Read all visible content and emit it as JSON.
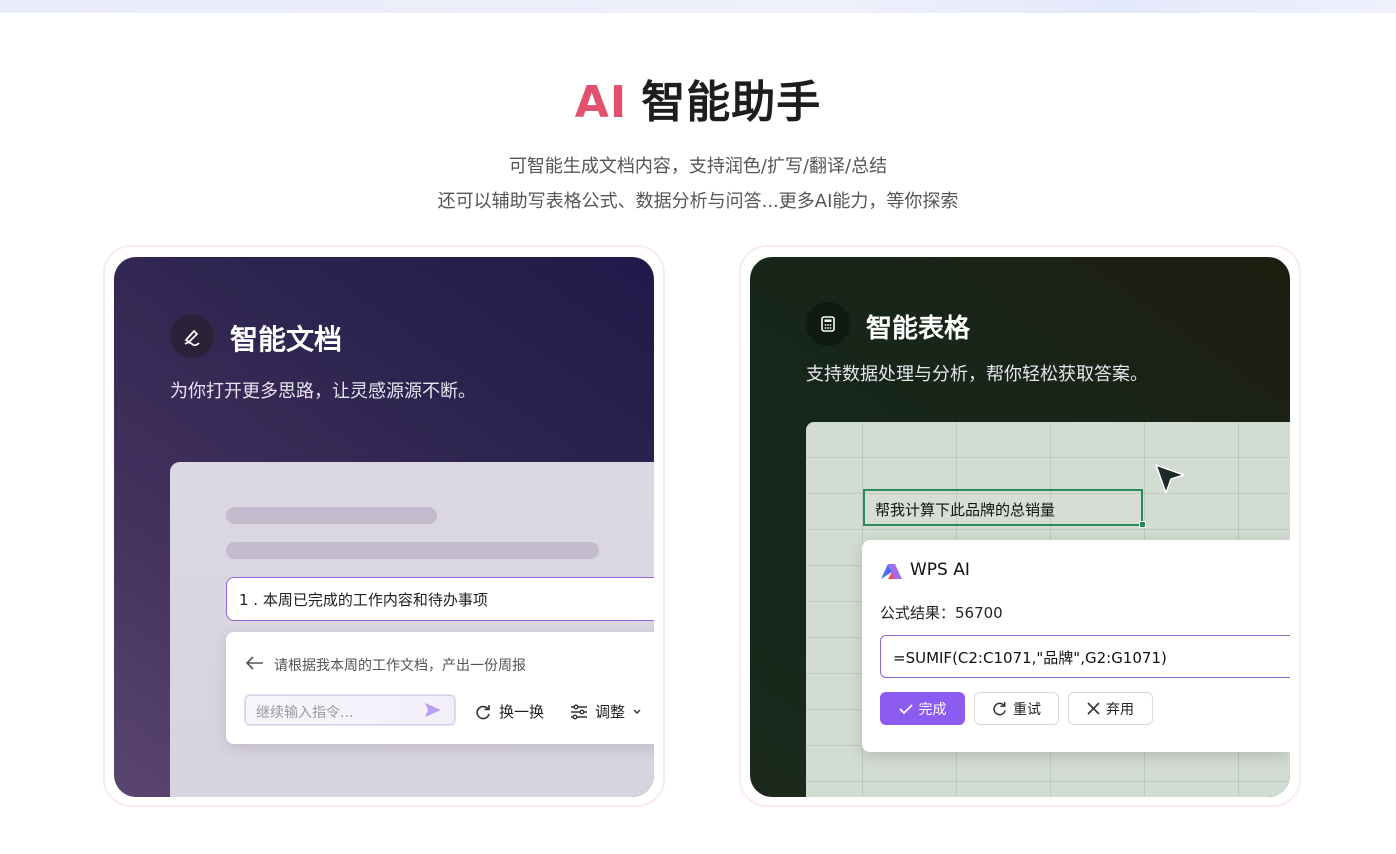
{
  "hero": {
    "title_ai": "AI",
    "title_rest": "智能助手",
    "subtitle_1": "可智能生成文档内容，支持润色/扩写/翻译/总结",
    "subtitle_2": "还可以辅助写表格公式、数据分析与问答...更多AI能力，等你探索"
  },
  "doc_card": {
    "icon": "pen-icon",
    "title": "智能文档",
    "desc": "为你打开更多思路，让灵感源源不断。",
    "prompt_line": "1 . 本周已完成的工作内容和待办事项",
    "panel_query": "请根据我本周的工作文档，产出一份周报",
    "input_placeholder": "继续输入指令...",
    "swap_label": "换一换",
    "adjust_label": "调整"
  },
  "sheet_card": {
    "icon": "calculator-icon",
    "title": "智能表格",
    "desc": "支持数据处理与分析，帮你轻松获取答案。",
    "cell_text": "帮我计算下此品牌的总销量",
    "ai_name": "WPS AI",
    "result_label": "公式结果：56700",
    "formula": "=SUMIF(C2:C1071,\"品牌\",G2:G1071)",
    "done_label": "完成",
    "retry_label": "重试",
    "discard_label": "弃用"
  },
  "colors": {
    "accent_pink": "#e2506f",
    "accent_purple": "#8c5cf0",
    "sheet_green": "#2b8a5a"
  }
}
